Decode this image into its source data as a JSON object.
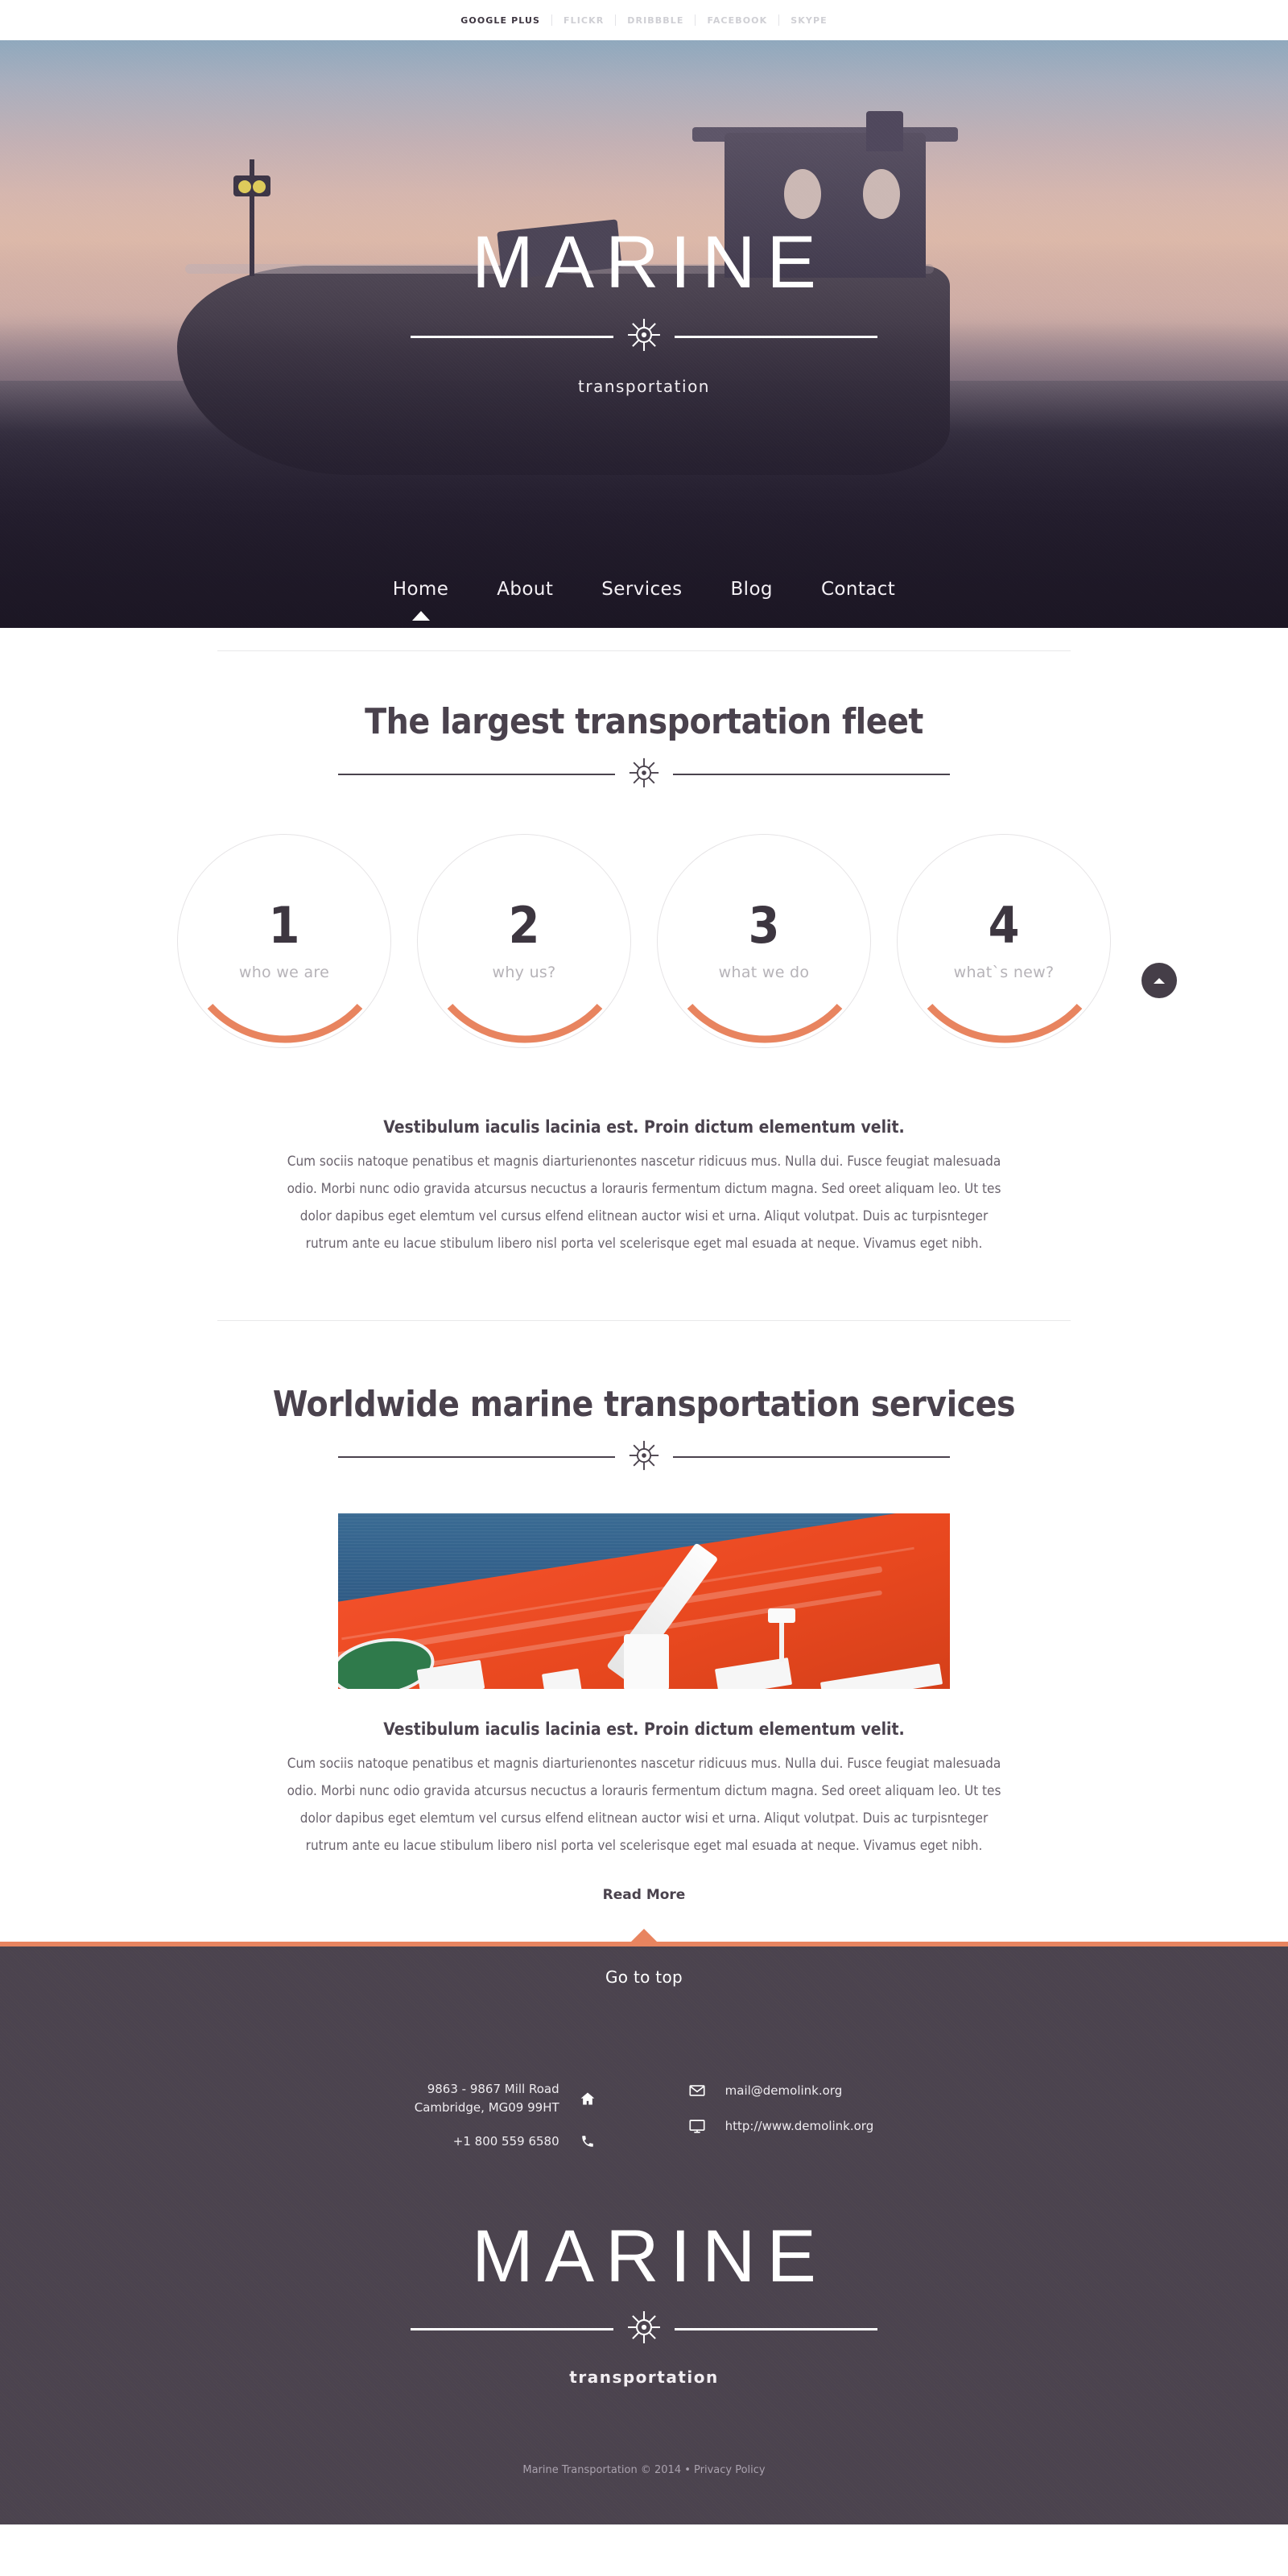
{
  "topbar": {
    "social": [
      {
        "label": "GOOGLE PLUS",
        "active": true
      },
      {
        "label": "FLICKR",
        "active": false
      },
      {
        "label": "DRIBBBLE",
        "active": false
      },
      {
        "label": "FACEBOOK",
        "active": false
      },
      {
        "label": "SKYPE",
        "active": false
      }
    ]
  },
  "hero": {
    "brand_title": "MARINE",
    "brand_sub": "transportation",
    "wheel_icon": "ship-wheel-icon",
    "nav": [
      {
        "label": "Home",
        "active": true
      },
      {
        "label": "About",
        "active": false
      },
      {
        "label": "Services",
        "active": false
      },
      {
        "label": "Blog",
        "active": false
      },
      {
        "label": "Contact",
        "active": false
      }
    ]
  },
  "fleet_section": {
    "title": "The largest transportation fleet",
    "wheel_icon": "ship-wheel-icon",
    "circles": [
      {
        "number": "1",
        "label": "who we are"
      },
      {
        "number": "2",
        "label": "why us?"
      },
      {
        "number": "3",
        "label": "what we do"
      },
      {
        "number": "4",
        "label": "what`s new?"
      }
    ],
    "scroll_icon": "chevron-up-icon",
    "lead": "Vestibulum iaculis lacinia est. Proin dictum elementum velit.",
    "body": "Cum sociis natoque penatibus et magnis diarturienontes nascetur ridicuus mus. Nulla dui. Fusce feugiat malesuada odio. Morbi nunc odio gravida atcursus necuctus a lorauris fermentum dictum magna. Sed oreet aliquam leo. Ut tes dolor dapibus eget elemtum vel cursus elfend elitnean auctor wisi et urna. Aliqut volutpat. Duis ac turpisnteger rutrum ante eu lacue stibulum libero nisl porta vel scelerisque eget mal esuada at neque. Vivamus eget nibh."
  },
  "services_section": {
    "title": "Worldwide marine transportation services",
    "wheel_icon": "ship-wheel-icon",
    "photo_alt": "red-tanker-ship-photo",
    "lead": "Vestibulum iaculis lacinia est. Proin dictum elementum velit.",
    "body": "Cum sociis natoque penatibus et magnis diarturienontes nascetur ridicuus mus. Nulla dui. Fusce feugiat malesuada odio. Morbi nunc odio gravida atcursus necuctus a lorauris fermentum dictum magna. Sed oreet aliquam leo. Ut tes dolor dapibus eget elemtum vel cursus elfend elitnean auctor wisi et urna. Aliqut volutpat. Duis ac turpisnteger rutrum ante eu lacue stibulum libero nisl porta vel scelerisque eget mal esuada at neque. Vivamus eget nibh.",
    "read_more": "Read More"
  },
  "footer": {
    "goto_top": "Go to top",
    "address_line1": "9863 - 9867 Mill Road",
    "address_line2": "Cambridge, MG09 99HT",
    "phone": "+1 800 559 6580",
    "email": "mail@demolink.org",
    "website": "http://www.demolink.org",
    "icons": {
      "home": "home-icon",
      "phone": "phone-icon",
      "mail": "envelope-icon",
      "web": "monitor-icon"
    },
    "brand_title": "MARINE",
    "brand_sub": "transportation",
    "wheel_icon": "ship-wheel-icon",
    "copyright": "Marine Transportation © 2014 • Privacy Policy"
  },
  "colors": {
    "accent": "#e8845f",
    "dark": "#4b434e",
    "text": "#4a424d",
    "muted": "#b6b3b8"
  }
}
